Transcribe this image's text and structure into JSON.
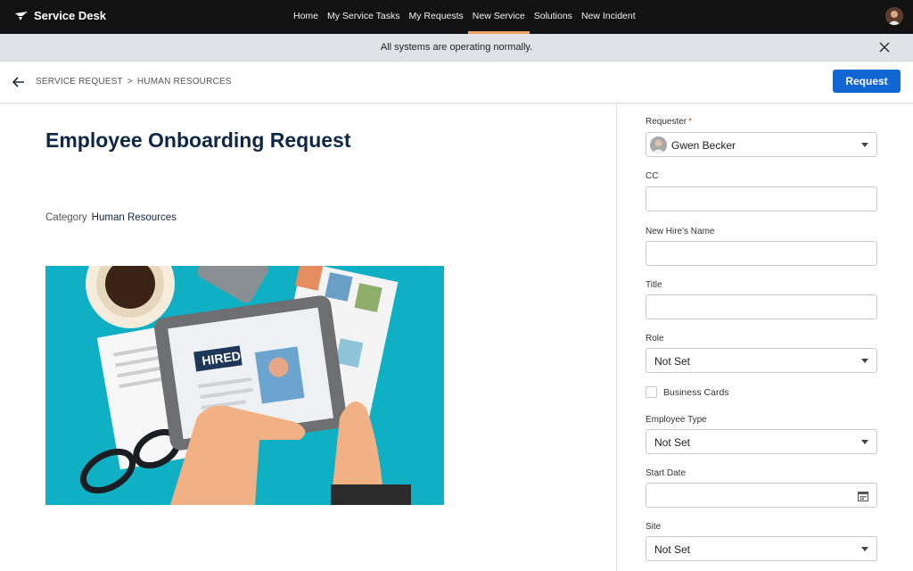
{
  "app": {
    "title": "Service Desk"
  },
  "nav": {
    "items": [
      {
        "label": "Home"
      },
      {
        "label": "My Service Tasks"
      },
      {
        "label": "My Requests"
      },
      {
        "label": "New Service"
      },
      {
        "label": "Solutions"
      },
      {
        "label": "New Incident"
      }
    ],
    "active": "New Service",
    "accent_color": "#f3a35d"
  },
  "banner": {
    "message": "All systems are operating normally."
  },
  "breadcrumb": {
    "parts": [
      "SERVICE REQUEST",
      ">",
      "HUMAN RESOURCES"
    ]
  },
  "actions": {
    "request_label": "Request",
    "primary_color": "#1266d4"
  },
  "page": {
    "title": "Employee Onboarding Request",
    "category_label": "Category",
    "category_value": "Human Resources",
    "illustration_text": "HIRED"
  },
  "form": {
    "requester": {
      "label": "Requester",
      "required_mark": "*",
      "value": "Gwen Becker"
    },
    "cc": {
      "label": "CC",
      "value": ""
    },
    "new_hire_name": {
      "label": "New Hire's Name",
      "value": ""
    },
    "title": {
      "label": "Title",
      "value": ""
    },
    "role": {
      "label": "Role",
      "value": "Not Set"
    },
    "business_cards": {
      "label": "Business Cards",
      "checked": false
    },
    "employee_type": {
      "label": "Employee Type",
      "value": "Not Set"
    },
    "start_date": {
      "label": "Start Date",
      "value": ""
    },
    "site": {
      "label": "Site",
      "value": "Not Set"
    }
  }
}
